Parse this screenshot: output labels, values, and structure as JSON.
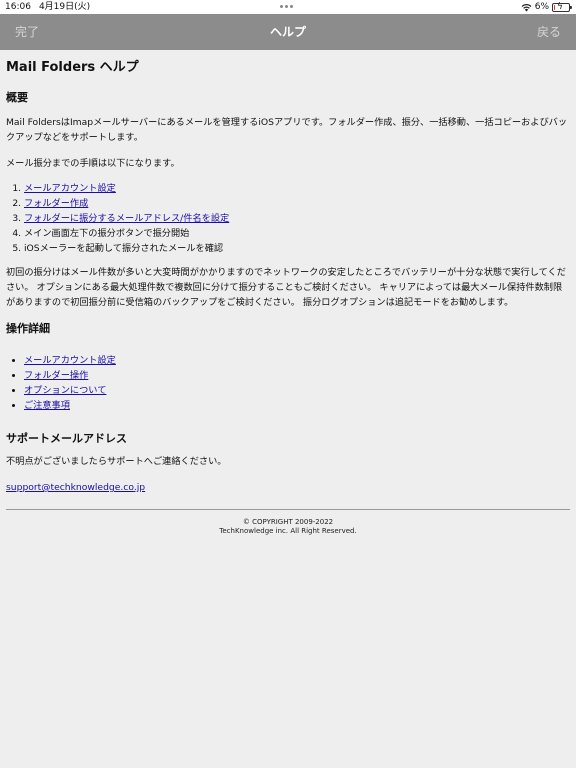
{
  "status": {
    "time": "16:06",
    "date": "4月19日(火)",
    "battery": "6%",
    "battery_level": 0.06
  },
  "nav": {
    "done": "完了",
    "title": "ヘルプ",
    "back": "戻る"
  },
  "page": {
    "title": "Mail Folders ヘルプ",
    "overview_heading": "概要",
    "overview_p1": "Mail FoldersはImapメールサーバーにあるメールを管理するiOSアプリです。フォルダー作成、振分、一括移動、一括コピーおよびバックアップなどをサポートします。",
    "overview_p2": "メール振分までの手順は以下になります。",
    "steps": [
      {
        "text": "メールアカウント設定",
        "link": true
      },
      {
        "text": "フォルダー作成",
        "link": true
      },
      {
        "text": "フォルダーに振分するメールアドレス/件名を設定",
        "link": true
      },
      {
        "text": "メイン画面左下の振分ボタンで振分開始",
        "link": false
      },
      {
        "text": "iOSメーラーを起動して振分されたメールを確認",
        "link": false
      }
    ],
    "overview_p3": "初回の振分けはメール件数が多いと大変時間がかかりますのでネットワークの安定したところでバッテリーが十分な状態で実行してください。 オプションにある最大処理件数で複数回に分けて振分することもご検討ください。 キャリアによっては最大メール保持件数制限がありますので初回振分前に受信箱のバックアップをご検討ください。 振分ログオプションは追記モードをお勧めします。",
    "ops_heading": "操作詳細",
    "ops": [
      "メールアカウント設定",
      "フォルダー操作",
      "オプションについて",
      "ご注意事項"
    ],
    "support_heading": "サポートメールアドレス",
    "support_text": "不明点がございましたらサポートへご連絡ください。",
    "support_email": "support@techknowledge.co.jp",
    "footer_line1": "© COPYRIGHT 2009-2022",
    "footer_line2": "TechKnowledge inc. All Right Reserved."
  },
  "colors": {
    "nav_bg": "#8c8c8c",
    "page_bg": "#eeeeee",
    "link": "#1a0dab",
    "battery_low": "#e0342f"
  }
}
